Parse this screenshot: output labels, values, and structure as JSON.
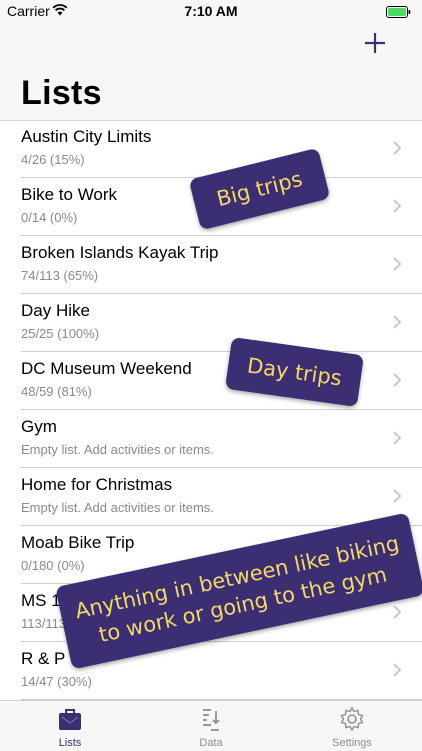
{
  "status_bar": {
    "carrier": "Carrier",
    "time": "7:10 AM"
  },
  "header": {
    "title": "Lists",
    "add_icon": "plus-icon"
  },
  "lists": [
    {
      "title": "Austin City Limits",
      "subtitle": "4/26  (15%)"
    },
    {
      "title": "Bike to Work",
      "subtitle": "0/14  (0%)"
    },
    {
      "title": "Broken Islands Kayak Trip",
      "subtitle": "74/113  (65%)"
    },
    {
      "title": "Day Hike",
      "subtitle": "25/25  (100%)"
    },
    {
      "title": "DC Museum Weekend",
      "subtitle": "48/59  (81%)"
    },
    {
      "title": "Gym",
      "subtitle": "Empty list. Add activities or items."
    },
    {
      "title": "Home for Christmas",
      "subtitle": "Empty list. Add activities or items."
    },
    {
      "title": "Moab Bike Trip",
      "subtitle": "0/180  (0%)"
    },
    {
      "title": "MS 1",
      "subtitle": "113/113"
    },
    {
      "title": "R & P",
      "subtitle": "14/47  (30%)"
    }
  ],
  "badges": {
    "big_trips": "Big trips",
    "day_trips": "Day trips",
    "between_line1": "Anything in between like biking",
    "between_line2": "to work or going to the gym"
  },
  "tabs": [
    {
      "label": "Lists",
      "icon": "briefcase-icon",
      "active": true
    },
    {
      "label": "Data",
      "icon": "data-sort-icon",
      "active": false
    },
    {
      "label": "Settings",
      "icon": "gear-icon",
      "active": false
    }
  ],
  "colors": {
    "accent": "#3b2e72",
    "badge_text": "#f6d867",
    "inactive": "#8e8e93",
    "subtitle": "#8a8a8a"
  }
}
